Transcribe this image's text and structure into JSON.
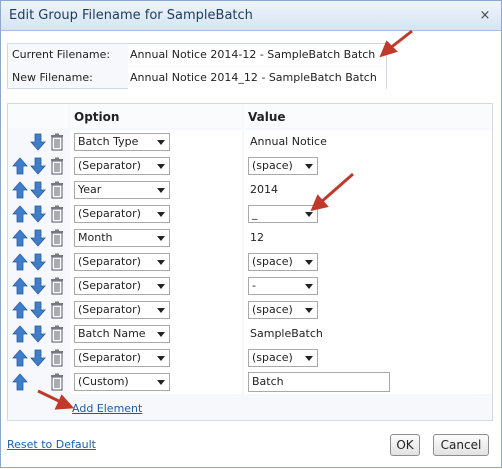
{
  "dialog": {
    "title": "Edit Group Filename for SampleBatch",
    "close_glyph": "×"
  },
  "filenames": {
    "current_label": "Current Filename:",
    "current_value": "Annual Notice 2014-12 - SampleBatch Batch",
    "new_label": "New Filename:",
    "new_value": "Annual Notice 2014_12 - SampleBatch Batch"
  },
  "grid": {
    "option_header": "Option",
    "value_header": "Value",
    "rows": [
      {
        "option": "Batch Type",
        "value_kind": "text",
        "value": "Annual Notice",
        "up": false
      },
      {
        "option": "(Separator)",
        "value_kind": "select",
        "value": "(space)",
        "up": true
      },
      {
        "option": "Year",
        "value_kind": "text",
        "value": "2014",
        "up": true
      },
      {
        "option": "(Separator)",
        "value_kind": "select",
        "value": "_",
        "up": true
      },
      {
        "option": "Month",
        "value_kind": "text",
        "value": "12",
        "up": true
      },
      {
        "option": "(Separator)",
        "value_kind": "select",
        "value": "(space)",
        "up": true
      },
      {
        "option": "(Separator)",
        "value_kind": "select",
        "value": "-",
        "up": true
      },
      {
        "option": "(Separator)",
        "value_kind": "select",
        "value": "(space)",
        "up": true
      },
      {
        "option": "Batch Name",
        "value_kind": "text",
        "value": "SampleBatch",
        "up": true
      },
      {
        "option": "(Separator)",
        "value_kind": "select",
        "value": "(space)",
        "up": true
      },
      {
        "option": "(Custom)",
        "value_kind": "input",
        "value": "Batch",
        "up": true,
        "down": false
      }
    ],
    "add_element": "Add Element"
  },
  "footer": {
    "reset": "Reset to Default",
    "ok": "OK",
    "cancel": "Cancel"
  },
  "colors": {
    "arrow_blue": "#3f7fc9",
    "annotation_red": "#c0392b",
    "link": "#1c5ea8"
  }
}
